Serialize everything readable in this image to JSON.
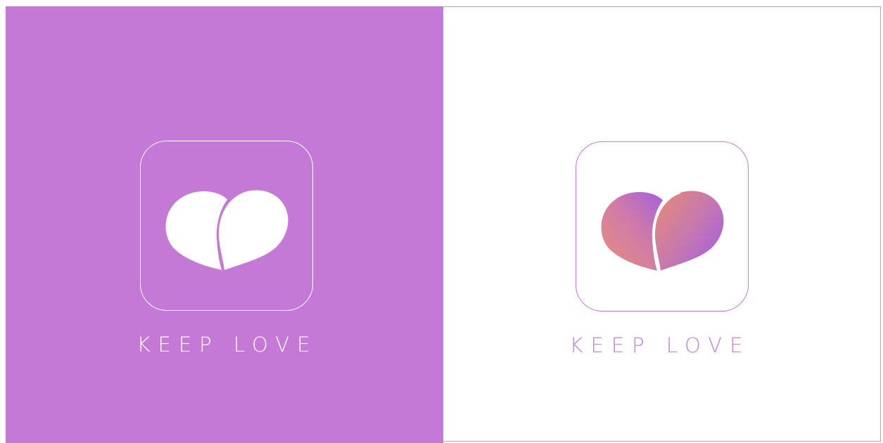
{
  "colors": {
    "left_background": "#c479d6",
    "right_background": "#ffffff",
    "left_icon_stroke": "#ffffff",
    "right_icon_stroke": "#c77ad6",
    "gradient_start": "#e38a77",
    "gradient_end": "#a55de0"
  },
  "icons": {
    "left": "heart-logo-icon",
    "right": "heart-logo-gradient-icon"
  },
  "left_panel": {
    "caption": "KEEP LOVE"
  },
  "right_panel": {
    "caption": "KEEP LOVE"
  }
}
